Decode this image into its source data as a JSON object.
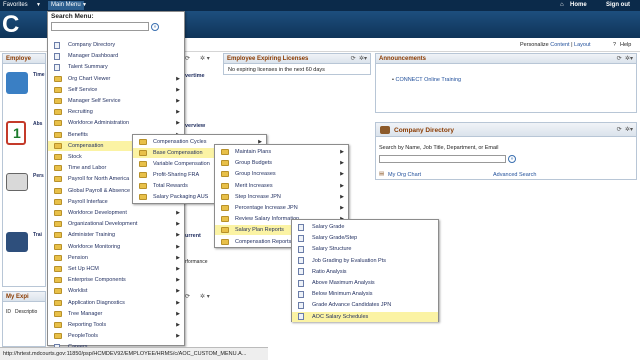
{
  "topbar": {
    "favorites": "Favorites",
    "main_menu": "Main Menu",
    "home": "Home",
    "sign_out": "Sign out"
  },
  "subbar": {
    "personalize": "Personalize",
    "content": "Content",
    "sep": "|",
    "layout": "Layout",
    "help": "Help"
  },
  "left_pagelets": {
    "employee": "Employe",
    "time_title": "Time",
    "abs_title": "Abs",
    "pers_title": "Pers",
    "train_title": "Trai",
    "my_expiring": "My Expi",
    "id_col": "ID",
    "desc_col": "Descriptio"
  },
  "mid_pagelet_texts": {
    "overtime": "vertime",
    "p1": "n your timesheet, view or add your",
    "overview": "verview",
    "calendar": "alendar",
    "current": "urrent",
    "your_current": "your current",
    "da": "da",
    "formance": "rformance",
    "current2": "current"
  },
  "licenses": {
    "title": "Employee Expiring Licenses",
    "body": "No expiring licenses in the next 60 days"
  },
  "announcements": {
    "title": "Announcements",
    "item": "CONNECT Online Training"
  },
  "company_directory": {
    "title": "Company Directory",
    "search_label": "Search by Name, Job Title, Department, or Email",
    "search_value": "",
    "my_org_chart": "My Org Chart",
    "advanced_search": "Advanced Search"
  },
  "search_menu": {
    "label": "Search Menu:",
    "value": ""
  },
  "main_menu_items": [
    {
      "label": "Company Directory",
      "icon": "doc"
    },
    {
      "label": "Manager Dashboard",
      "icon": "doc"
    },
    {
      "label": "Talent Summary",
      "icon": "doc"
    },
    {
      "label": "Org Chart Viewer",
      "icon": "folder",
      "sub": true
    },
    {
      "label": "Self Service",
      "icon": "folder",
      "sub": true
    },
    {
      "label": "Manager Self Service",
      "icon": "folder",
      "sub": true
    },
    {
      "label": "Recruiting",
      "icon": "folder",
      "sub": true
    },
    {
      "label": "Workforce Administration",
      "icon": "folder",
      "sub": true
    },
    {
      "label": "Benefits",
      "icon": "folder",
      "sub": true
    },
    {
      "label": "Compensation",
      "icon": "folder",
      "sub": true,
      "hl": true
    },
    {
      "label": "Stock",
      "icon": "folder",
      "sub": true
    },
    {
      "label": "Time and Labor",
      "icon": "folder",
      "sub": true
    },
    {
      "label": "Payroll for North America",
      "icon": "folder",
      "sub": true
    },
    {
      "label": "Global Payroll & Absence",
      "icon": "folder",
      "sub": true
    },
    {
      "label": "Payroll Interface",
      "icon": "folder",
      "sub": true
    },
    {
      "label": "Workforce Development",
      "icon": "folder",
      "sub": true
    },
    {
      "label": "Organizational Development",
      "icon": "folder",
      "sub": true
    },
    {
      "label": "Administer Training",
      "icon": "folder",
      "sub": true
    },
    {
      "label": "Workforce Monitoring",
      "icon": "folder",
      "sub": true
    },
    {
      "label": "Pension",
      "icon": "folder",
      "sub": true
    },
    {
      "label": "Set Up HCM",
      "icon": "folder",
      "sub": true
    },
    {
      "label": "Enterprise Components",
      "icon": "folder",
      "sub": true
    },
    {
      "label": "Worklist",
      "icon": "folder",
      "sub": true
    },
    {
      "label": "Application Diagnostics",
      "icon": "folder",
      "sub": true
    },
    {
      "label": "Tree Manager",
      "icon": "folder",
      "sub": true
    },
    {
      "label": "Reporting Tools",
      "icon": "folder",
      "sub": true
    },
    {
      "label": "PeopleTools",
      "icon": "folder",
      "sub": true
    },
    {
      "label": "Careers",
      "icon": "doc"
    }
  ],
  "compensation_items": [
    {
      "label": "Compensation Cycles",
      "icon": "folder",
      "sub": true
    },
    {
      "label": "Base Compensation",
      "icon": "folder",
      "sub": true,
      "hl": true
    },
    {
      "label": "Variable Compensation",
      "icon": "folder",
      "sub": true
    },
    {
      "label": "Profit-Sharing FRA",
      "icon": "folder",
      "sub": true
    },
    {
      "label": "Total Rewards",
      "icon": "folder",
      "sub": true
    },
    {
      "label": "Salary Packaging AUS",
      "icon": "folder",
      "sub": true
    }
  ],
  "base_comp_items": [
    {
      "label": "Maintain Plans",
      "icon": "folder",
      "sub": true
    },
    {
      "label": "Group Budgets",
      "icon": "folder",
      "sub": true
    },
    {
      "label": "Group Increases",
      "icon": "folder",
      "sub": true
    },
    {
      "label": "Merit Increases",
      "icon": "folder",
      "sub": true
    },
    {
      "label": "Step Increase JPN",
      "icon": "folder",
      "sub": true
    },
    {
      "label": "Percentage Increase JPN",
      "icon": "folder",
      "sub": true
    },
    {
      "label": "Review Salary Information",
      "icon": "folder",
      "sub": true
    },
    {
      "label": "Salary Plan Reports",
      "icon": "folder",
      "sub": true,
      "hl": true
    },
    {
      "label": "Compensation Reports",
      "icon": "folder",
      "sub": true
    }
  ],
  "salary_reports_items": [
    {
      "label": "Salary Grade",
      "icon": "doc"
    },
    {
      "label": "Salary Grade/Step",
      "icon": "doc"
    },
    {
      "label": "Salary Structure",
      "icon": "doc"
    },
    {
      "label": "Job Grading by Evaluation Pts",
      "icon": "doc"
    },
    {
      "label": "Ratio Analysis",
      "icon": "doc"
    },
    {
      "label": "Above Maximum Analysis",
      "icon": "doc"
    },
    {
      "label": "Below Minimum Analysis",
      "icon": "doc"
    },
    {
      "label": "Grade Advance Candidates JPN",
      "icon": "doc"
    },
    {
      "label": "AOC Salary Schedules",
      "icon": "doc",
      "hl": true
    }
  ],
  "status_url": "http://hrtest.mdcourts.gov:11850/psp/HCMDEV92/EMPLOYEE/HRMS/c/AOC_CUSTOM_MENU.A..."
}
